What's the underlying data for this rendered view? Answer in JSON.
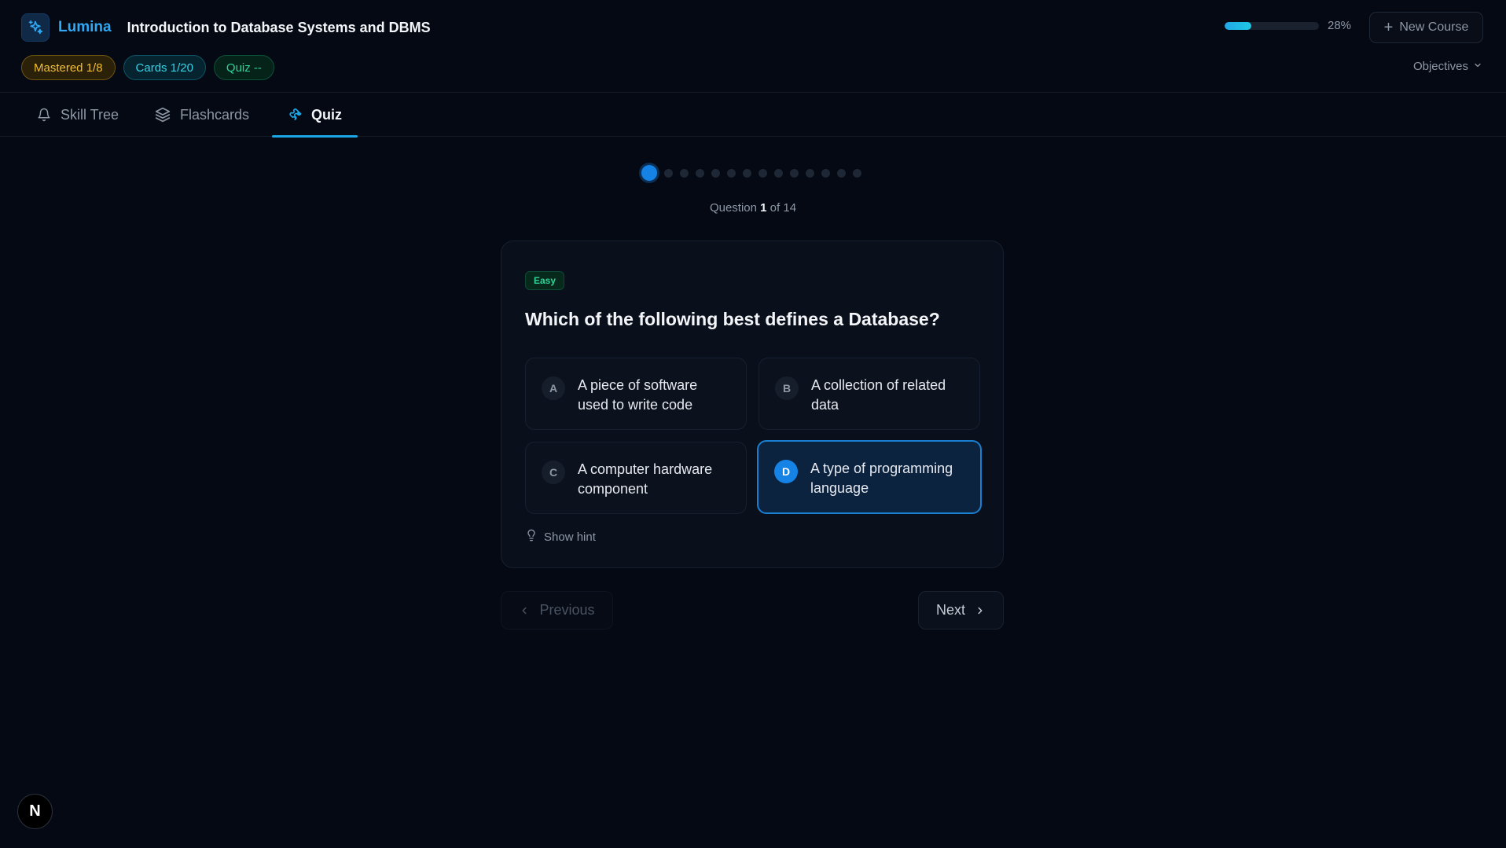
{
  "app": {
    "brand": "Lumina",
    "course_title": "Introduction to Database Systems and DBMS",
    "progress_percent": 28,
    "progress_label": "28%",
    "new_course_label": "New Course",
    "objectives_label": "Objectives"
  },
  "badges": {
    "mastered": "Mastered 1/8",
    "cards": "Cards 1/20",
    "quiz": "Quiz --"
  },
  "tabs": [
    {
      "label": "Skill Tree",
      "icon": "bell-icon",
      "active": false
    },
    {
      "label": "Flashcards",
      "icon": "layers-icon",
      "active": false
    },
    {
      "label": "Quiz",
      "icon": "puzzle-icon",
      "active": true
    }
  ],
  "quiz": {
    "total_questions": 14,
    "current_index": 1,
    "counter_prefix": "Question",
    "counter_current": "1",
    "counter_suffix": "of 14",
    "difficulty": "Easy",
    "question": "Which of the following best defines a Database?",
    "options": [
      {
        "letter": "A",
        "text": "A piece of software used to write code",
        "selected": false
      },
      {
        "letter": "B",
        "text": "A collection of related data",
        "selected": false
      },
      {
        "letter": "C",
        "text": "A computer hardware component",
        "selected": false
      },
      {
        "letter": "D",
        "text": "A type of programming language",
        "selected": true
      }
    ],
    "hint_label": "Show hint",
    "previous_label": "Previous",
    "next_label": "Next"
  },
  "colors": {
    "accent": "#1583e6",
    "brand": "#2fa8f5",
    "background": "#050913"
  },
  "footer": {
    "avatar_letter": "N"
  }
}
